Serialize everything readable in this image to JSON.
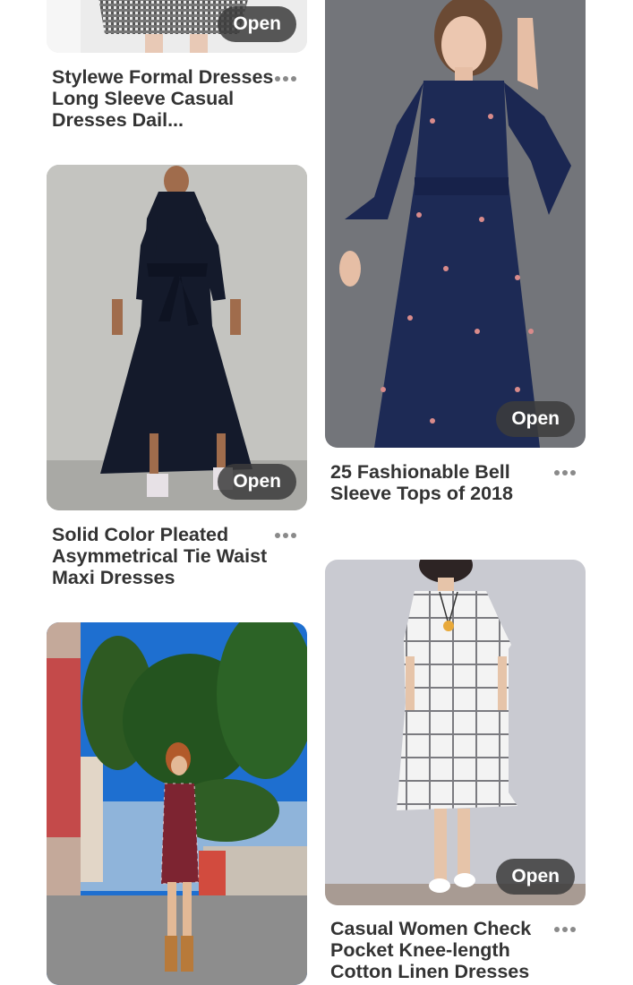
{
  "pins": [
    {
      "title": "Stylewe Formal Dresses Long Sleeve Casual Dresses Dail...",
      "open_label": "Open"
    },
    {
      "title": "25 Fashionable Bell Sleeve Tops of 2018",
      "open_label": "Open"
    },
    {
      "title": "Solid Color Pleated Asymmetrical Tie Waist Maxi Dresses",
      "open_label": "Open"
    },
    {
      "title": "Casual Women Check Pocket Knee-length Cotton Linen Dresses",
      "open_label": "Open"
    },
    {
      "title": "",
      "open_label": ""
    }
  ],
  "icons": {
    "more": "more-horizontal-icon"
  }
}
